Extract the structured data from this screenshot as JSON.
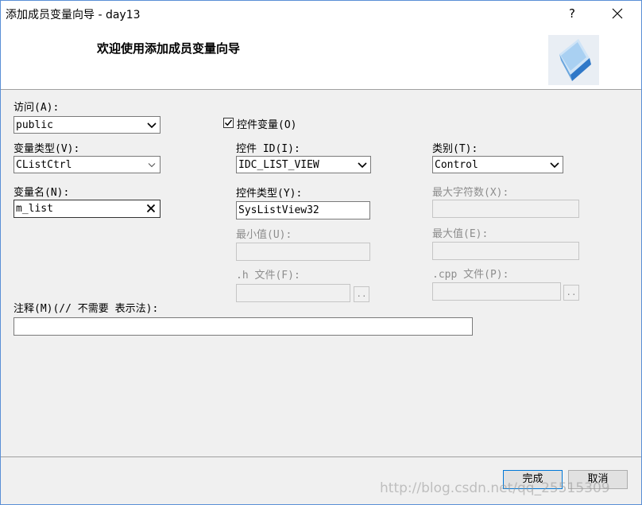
{
  "window": {
    "title": "添加成员变量向导 - day13",
    "help_label": "?",
    "close_icon": "close-icon"
  },
  "header": {
    "title": "欢迎使用添加成员变量向导",
    "icon": "wizard-cube-icon"
  },
  "form": {
    "access": {
      "label": "访问(A):",
      "value": "public"
    },
    "control_variable": {
      "label": "控件变量(O)",
      "checked": true
    },
    "variable_type": {
      "label": "变量类型(V):",
      "value": "CListCtrl"
    },
    "control_id": {
      "label": "控件 ID(I):",
      "value": "IDC_LIST_VIEW"
    },
    "category": {
      "label": "类别(T):",
      "value": "Control"
    },
    "variable_name": {
      "label": "变量名(N):",
      "value": "m_list"
    },
    "control_type": {
      "label": "控件类型(Y):",
      "value": "SysListView32"
    },
    "max_chars": {
      "label": "最大字符数(X):",
      "value": ""
    },
    "min_value": {
      "label": "最小值(U):",
      "value": ""
    },
    "max_value": {
      "label": "最大值(E):",
      "value": ""
    },
    "h_file": {
      "label": ".h 文件(F):",
      "value": "",
      "browse_label": ".."
    },
    "cpp_file": {
      "label": ".cpp 文件(P):",
      "value": "",
      "browse_label": ".."
    },
    "comment": {
      "label": "注释(M)(// 不需要 表示法):",
      "value": ""
    }
  },
  "footer": {
    "finish_label": "完成",
    "cancel_label": "取消"
  },
  "watermark": "http://blog.csdn.net/qq_25515309",
  "colors": {
    "accent": "#0078d7",
    "border": "#5a8fd6",
    "disabled_text": "#8d8d8d"
  }
}
